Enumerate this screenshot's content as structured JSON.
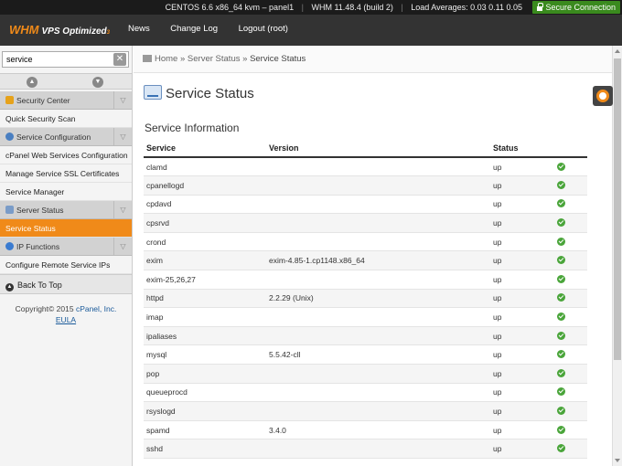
{
  "topbar": {
    "host": "CENTOS 6.6 x86_64 kvm – panel1",
    "version": "WHM 11.48.4 (build 2)",
    "load": "Load Averages: 0.03 0.11 0.05",
    "secure": "Secure Connection"
  },
  "header": {
    "logo_whm": "WHM",
    "logo_vps": "VPS Optimized",
    "logo_sub": "3",
    "nav": [
      "News",
      "Change Log",
      "Logout (root)"
    ]
  },
  "sidebar": {
    "search_value": "service",
    "clear_glyph": "✕",
    "categories": {
      "security": "Security Center",
      "service_config": "Service Configuration",
      "server_status": "Server Status",
      "ip_functions": "IP Functions"
    },
    "items": {
      "quick_scan": "Quick Security Scan",
      "cpanel_web_services": "cPanel Web Services Configuration",
      "manage_ssl": "Manage Service SSL Certificates",
      "service_manager": "Service Manager",
      "service_status": "Service Status",
      "configure_remote_ips": "Configure Remote Service IPs"
    },
    "back_to_top": "Back To Top",
    "copyright": "Copyright© 2015",
    "copyright_link": "cPanel, Inc.",
    "eula": "EULA"
  },
  "breadcrumb": {
    "home": "Home",
    "sep": "»",
    "section": "Server Status",
    "current": "Service Status"
  },
  "page": {
    "title": "Service Status",
    "section_title": "Service Information",
    "columns": {
      "service": "Service",
      "version": "Version",
      "status": "Status"
    },
    "rows": [
      {
        "service": "clamd",
        "version": "",
        "status": "up"
      },
      {
        "service": "cpanellogd",
        "version": "",
        "status": "up"
      },
      {
        "service": "cpdavd",
        "version": "",
        "status": "up"
      },
      {
        "service": "cpsrvd",
        "version": "",
        "status": "up"
      },
      {
        "service": "crond",
        "version": "",
        "status": "up"
      },
      {
        "service": "exim",
        "version": "exim-4.85-1.cp1148.x86_64",
        "status": "up"
      },
      {
        "service": "exim-25,26,27",
        "version": "",
        "status": "up"
      },
      {
        "service": "httpd",
        "version": "2.2.29 (Unix)",
        "status": "up"
      },
      {
        "service": "imap",
        "version": "",
        "status": "up"
      },
      {
        "service": "ipaliases",
        "version": "",
        "status": "up"
      },
      {
        "service": "mysql",
        "version": "5.5.42-cll",
        "status": "up"
      },
      {
        "service": "pop",
        "version": "",
        "status": "up"
      },
      {
        "service": "queueprocd",
        "version": "",
        "status": "up"
      },
      {
        "service": "rsyslogd",
        "version": "",
        "status": "up"
      },
      {
        "service": "spamd",
        "version": "3.4.0",
        "status": "up"
      },
      {
        "service": "sshd",
        "version": "",
        "status": "up"
      }
    ]
  },
  "colors": {
    "accent": "#f08a19",
    "header_bg": "#333333",
    "status_ok": "#4aa53a",
    "secure_bg": "#3a8a1e"
  }
}
